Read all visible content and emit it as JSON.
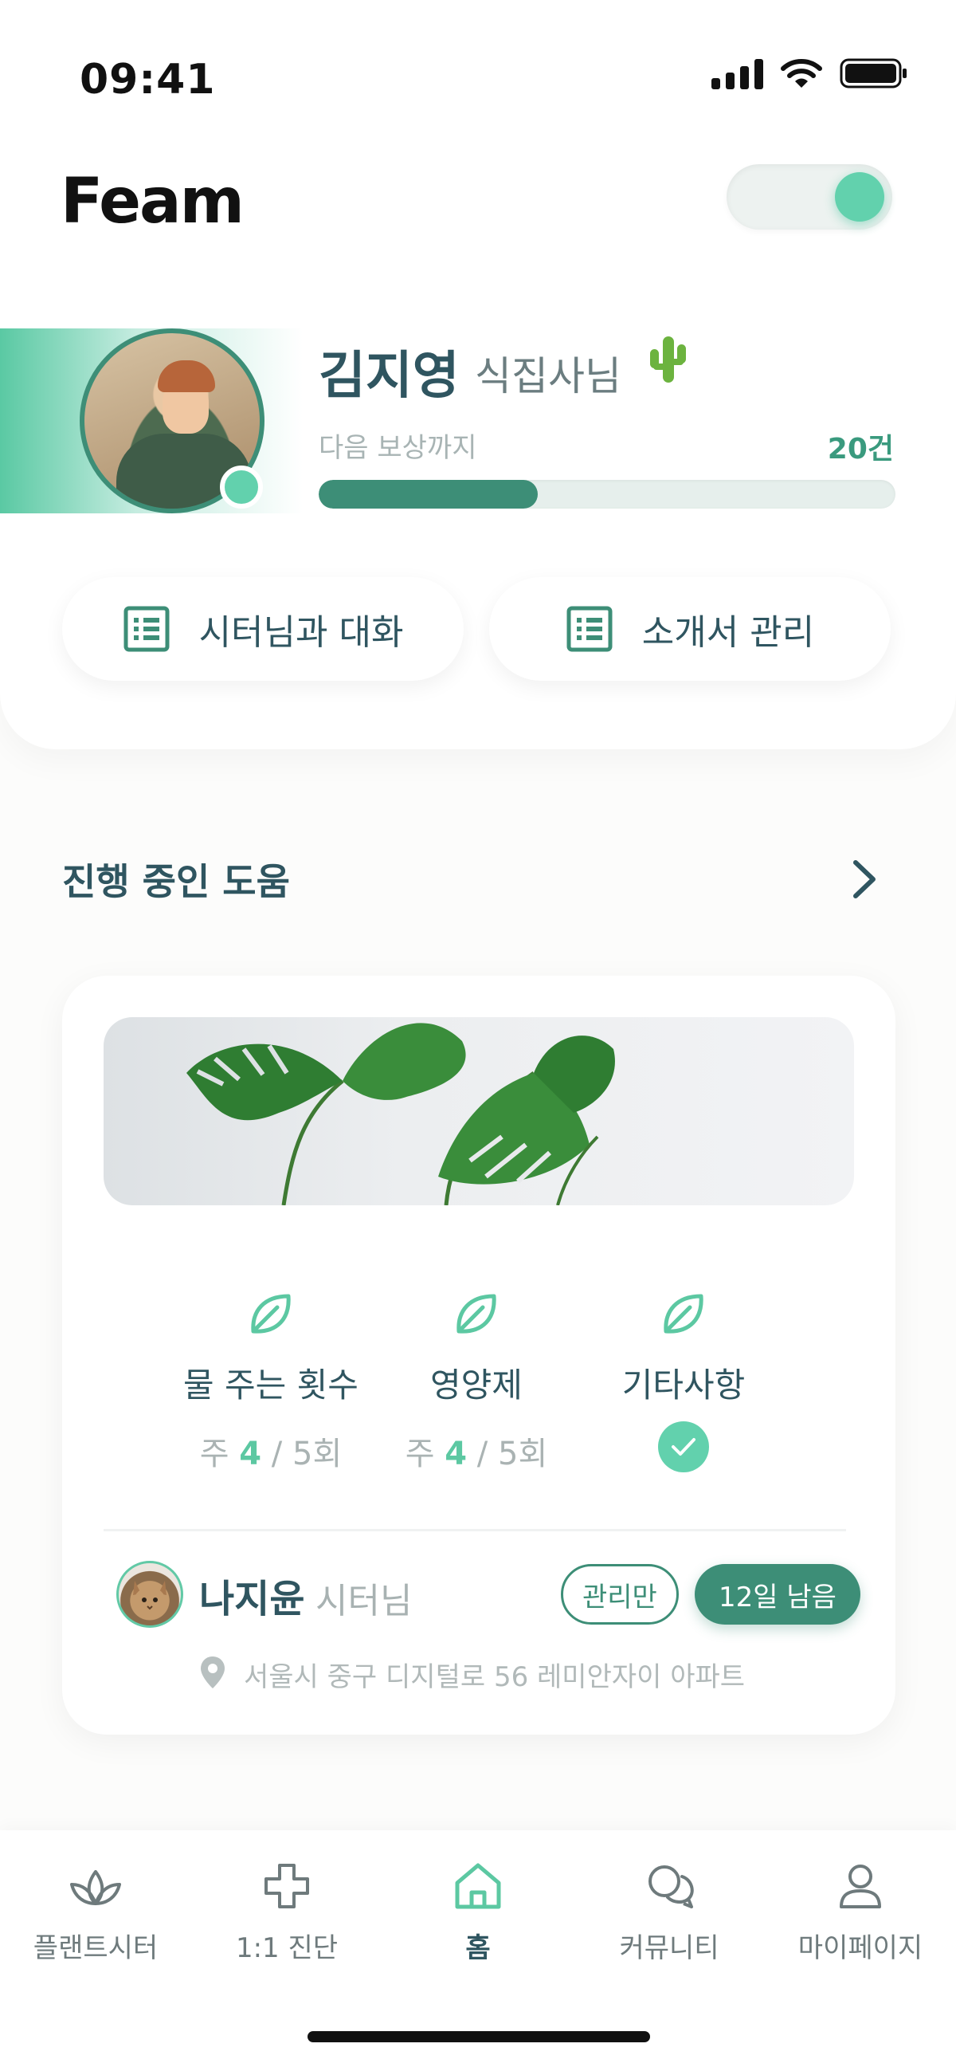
{
  "status_bar": {
    "time": "09:41"
  },
  "header": {
    "logo": "Feam",
    "toggle_on": true
  },
  "profile": {
    "name": "김지영",
    "suffix": "식집사님",
    "reward_label": "다음 보상까지",
    "reward_count": "20건",
    "reward_progress": 0.38
  },
  "actions": [
    {
      "label": "시터님과 대화",
      "icon": "list-icon"
    },
    {
      "label": "소개서 관리",
      "icon": "list-icon"
    }
  ],
  "section": {
    "title": "진행 중인 도움"
  },
  "card": {
    "stats": [
      {
        "label": "물 주는 횟수",
        "prefix": "주 ",
        "value": "4",
        "suffix": " / 5회"
      },
      {
        "label": "영양제",
        "prefix": "주 ",
        "value": "4",
        "suffix": " / 5회"
      },
      {
        "label": "기타사항",
        "checked": true
      }
    ],
    "sitter": {
      "name": "나지윤",
      "suffix": "시터님",
      "badge_outline": "관리만",
      "badge_filled": "12일 남음",
      "address": "서울시 중구 디지털로 56 레미안자이 아파트"
    }
  },
  "tabbar": {
    "tabs": [
      {
        "label": "플랜트시터",
        "icon": "lotus-icon"
      },
      {
        "label": "1:1 진단",
        "icon": "medical-cross-icon"
      },
      {
        "label": "홈",
        "icon": "home-icon",
        "active": true
      },
      {
        "label": "커뮤니티",
        "icon": "chat-bubbles-icon"
      },
      {
        "label": "마이페이지",
        "icon": "user-icon"
      }
    ]
  },
  "colors": {
    "accent": "#62d1ad",
    "primary": "#3d8e77",
    "text": "#2f5560"
  }
}
